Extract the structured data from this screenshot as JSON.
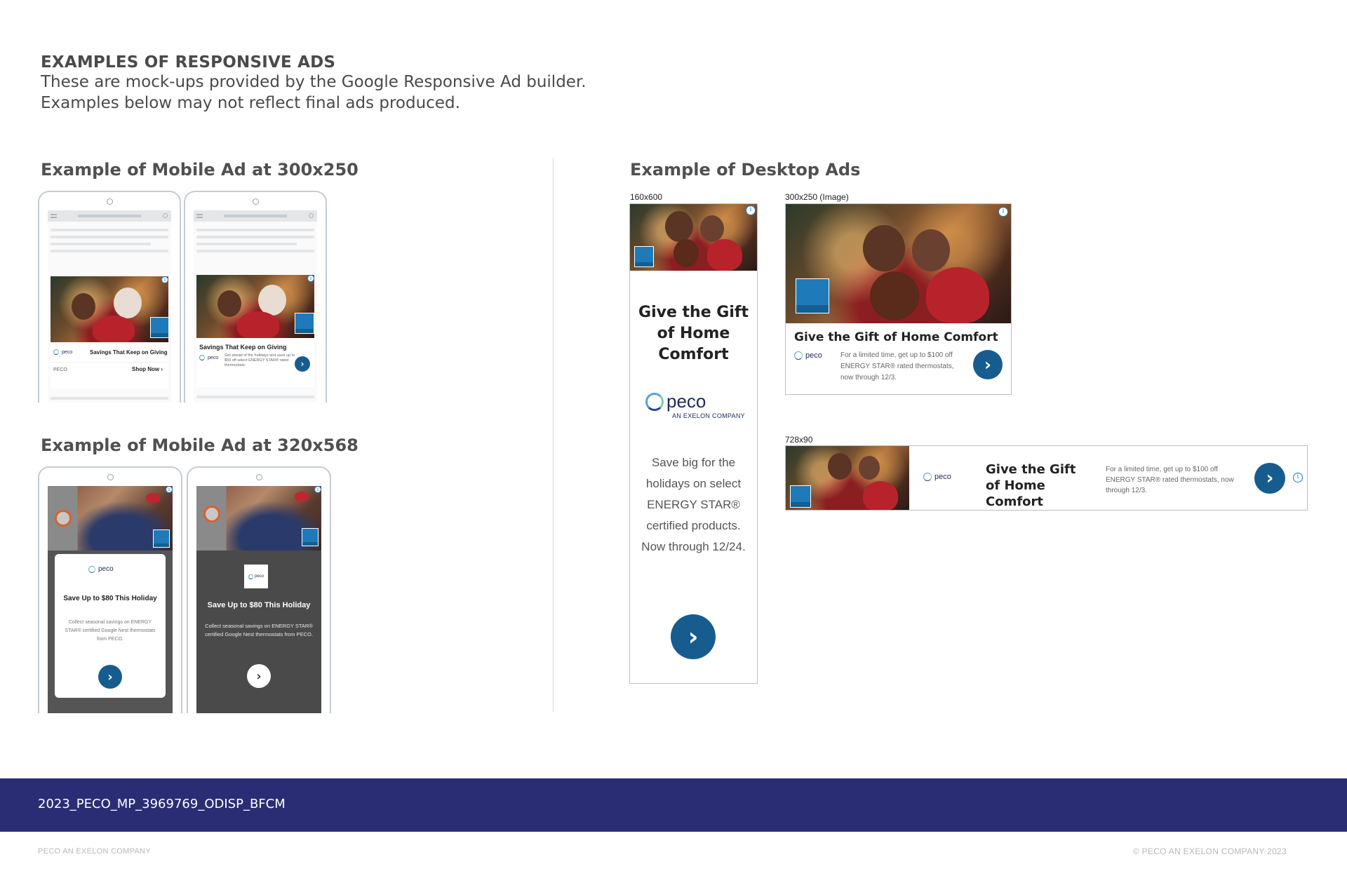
{
  "header": {
    "title": "EXAMPLES OF RESPONSIVE ADS",
    "line1": "These are mock-ups provided by the Google Responsive Ad builder.",
    "line2": "Examples below may not reflect final ads produced."
  },
  "sections": {
    "mobile_300": "Example of Mobile Ad at 300x250",
    "mobile_320": "Example of Mobile Ad at 320x568",
    "desktop": "Example of Desktop Ads"
  },
  "mobile_300": {
    "phone_a": {
      "headline": "Savings That Keep on Giving",
      "brand": "PECO",
      "cta": "Shop Now",
      "logo": "peco"
    },
    "phone_b": {
      "headline": "Savings That Keep on Giving",
      "body": "Get ahead of the holidays and save up to $50 off select ENERGY STAR® rated thermostats.",
      "logo": "peco"
    }
  },
  "mobile_320": {
    "phone_a": {
      "logo": "peco",
      "headline": "Save Up to $80 This Holiday",
      "body": "Collect seasonal savings on ENERGY STAR® certified Google Nest thermostats from PECO."
    },
    "phone_b": {
      "logo": "peco",
      "headline": "Save Up to $80 This Holiday",
      "body": "Collect seasonal savings on ENERGY STAR® certified Google Nest thermostats from PECO."
    }
  },
  "desktop": {
    "ad_160": {
      "size_label": "160x600",
      "headline": "Give the Gift of Home Comfort",
      "logo_word": "peco",
      "logo_tag": "AN EXELON COMPANY",
      "body": "Save big for the holidays on select ENERGY STAR® certified products. Now through 12/24."
    },
    "ad_300": {
      "size_label": "300x250 (Image)",
      "headline": "Give the Gift of Home Comfort",
      "logo_word": "peco",
      "body": "For a limited time, get up to $100 off ENERGY STAR® rated thermostats, now through 12/3."
    },
    "ad_728": {
      "size_label": "728x90",
      "headline": "Give the Gift of Home Comfort",
      "logo_word": "peco",
      "body": "For a limited time, get up to $100 off ENERGY STAR® rated thermostats, now through 12/3."
    },
    "info_glyph": "i"
  },
  "footer": {
    "job_code": "2023_PECO_MP_3969769_ODISP_BFCM",
    "left": "PECO AN EXELON COMPANY",
    "right": "© PECO AN EXELON COMPANY 2023"
  },
  "colors": {
    "footer_bar": "#2b2d74",
    "cta_blue": "#165c8f",
    "energy_star_blue": "#1e7ab8",
    "peco_navy": "#1d2a57"
  },
  "icons": [
    "chevron-right-icon",
    "info-icon",
    "hamburger-icon",
    "search-icon",
    "energy-star-logo",
    "peco-logo"
  ]
}
